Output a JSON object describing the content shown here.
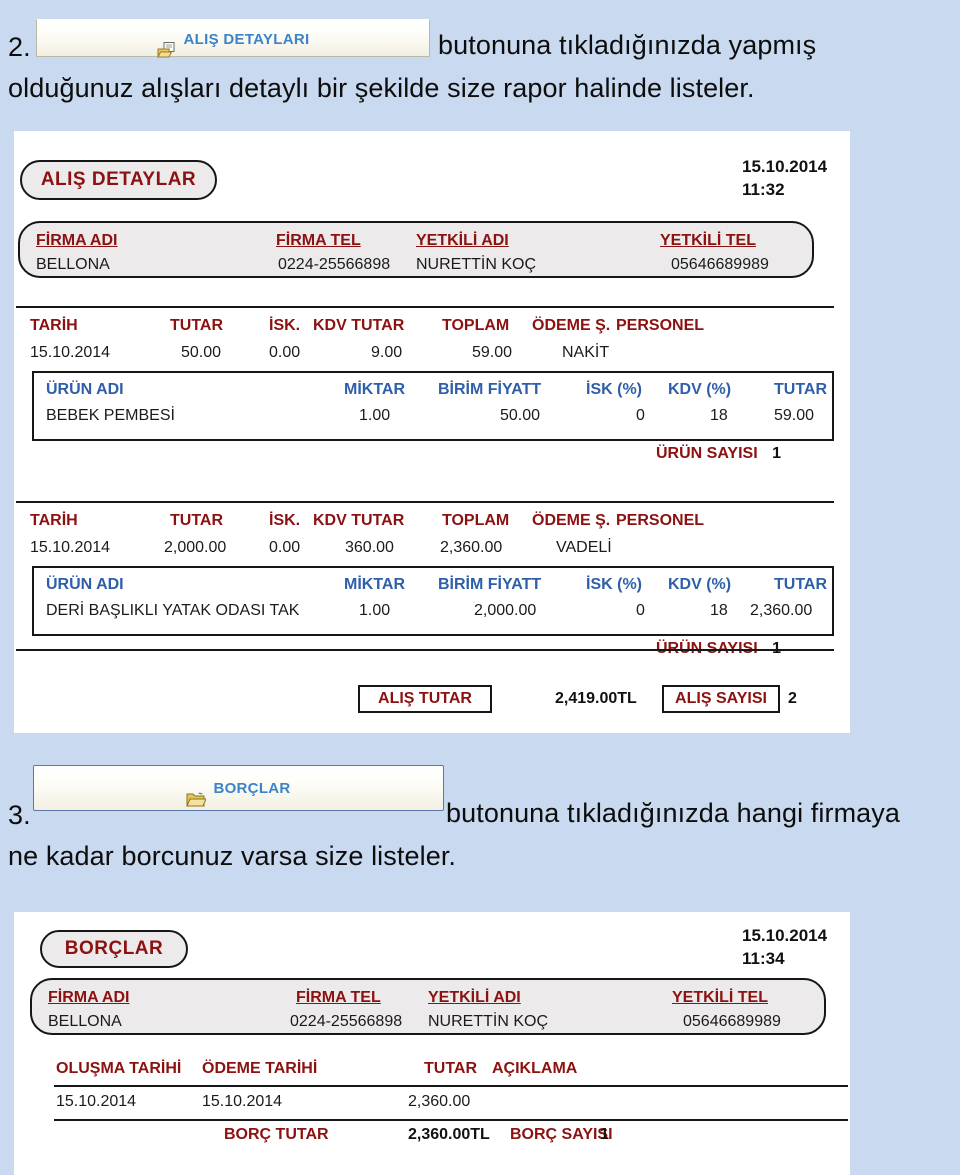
{
  "background_color": "#c9d9ef",
  "steps": [
    {
      "number": "2.",
      "button": {
        "label": "ALIŞ DETAYLARI",
        "icon": "print-document-icon"
      },
      "text_after": "butonuna tıkladığınızda  yapmış",
      "text_line2": "olduğunuz alışları detaylı bir şekilde size rapor halinde listeler."
    },
    {
      "number": "3.",
      "button": {
        "label": "BORÇLAR",
        "icon": "folder-icon"
      },
      "text_after": "butonuna tıkladığınızda hangi firmaya",
      "text_line2": "ne kadar borcunuz varsa size listeler."
    }
  ],
  "report_purchase": {
    "title": "ALIŞ DETAYLAR",
    "stamp_date": "15.10.2014",
    "stamp_time": "11:32",
    "firm": {
      "headers": [
        "FİRMA ADI",
        "FİRMA TEL",
        "YETKİLİ ADI",
        "YETKİLİ TEL"
      ],
      "values": [
        "BELLONA",
        "0224-25566898",
        "NURETTİN KOÇ",
        "05646689989"
      ]
    },
    "purchase_headers": [
      "TARİH",
      "TUTAR",
      "İSK.",
      "KDV TUTAR",
      "TOPLAM",
      "ÖDEME Ş.",
      "PERSONEL"
    ],
    "product_headers": [
      "ÜRÜN ADI",
      "MİKTAR",
      "BİRİM FİYATT",
      "İSK (%)",
      "KDV (%)",
      "TUTAR"
    ],
    "product_count_label": "ÜRÜN SAYISI",
    "blocks": [
      {
        "purchase_values": [
          "15.10.2014",
          "50.00",
          "0.00",
          "9.00",
          "59.00",
          "NAKİT",
          ""
        ],
        "products": [
          {
            "name": "BEBEK PEMBESİ",
            "qty": "1.00",
            "unit_price": "50.00",
            "disc": "0",
            "kdv": "18",
            "total": "59.00"
          }
        ],
        "product_count": "1"
      },
      {
        "purchase_values": [
          "15.10.2014",
          "2,000.00",
          "0.00",
          "360.00",
          "2,360.00",
          "VADELİ",
          ""
        ],
        "products": [
          {
            "name": "DERİ BAŞLIKLI YATAK ODASI TAK",
            "qty": "1.00",
            "unit_price": "2,000.00",
            "disc": "0",
            "kdv": "18",
            "total": "2,360.00"
          }
        ],
        "product_count": "1"
      }
    ],
    "footer": {
      "total_label": "ALIŞ TUTAR",
      "total_value": "2,419.00TL",
      "count_label": "ALIŞ SAYISI",
      "count_value": "2"
    }
  },
  "report_debts": {
    "title": "BORÇLAR",
    "stamp_date": "15.10.2014",
    "stamp_time": "11:34",
    "firm": {
      "headers": [
        "FİRMA ADI",
        "FİRMA TEL",
        "YETKİLİ ADI",
        "YETKİLİ TEL"
      ],
      "values": [
        "BELLONA",
        "0224-25566898",
        "NURETTİN KOÇ",
        "05646689989"
      ]
    },
    "table_headers": [
      "OLUŞMA TARİHİ",
      "ÖDEME TARİHİ",
      "TUTAR",
      "AÇIKLAMA"
    ],
    "rows": [
      {
        "created": "15.10.2014",
        "payment": "15.10.2014",
        "amount": "2,360.00",
        "note": ""
      }
    ],
    "footer": {
      "total_label": "BORÇ TUTAR",
      "total_value": "2,360.00TL",
      "count_label": "BORÇ SAYISI",
      "count_value": "1"
    }
  }
}
